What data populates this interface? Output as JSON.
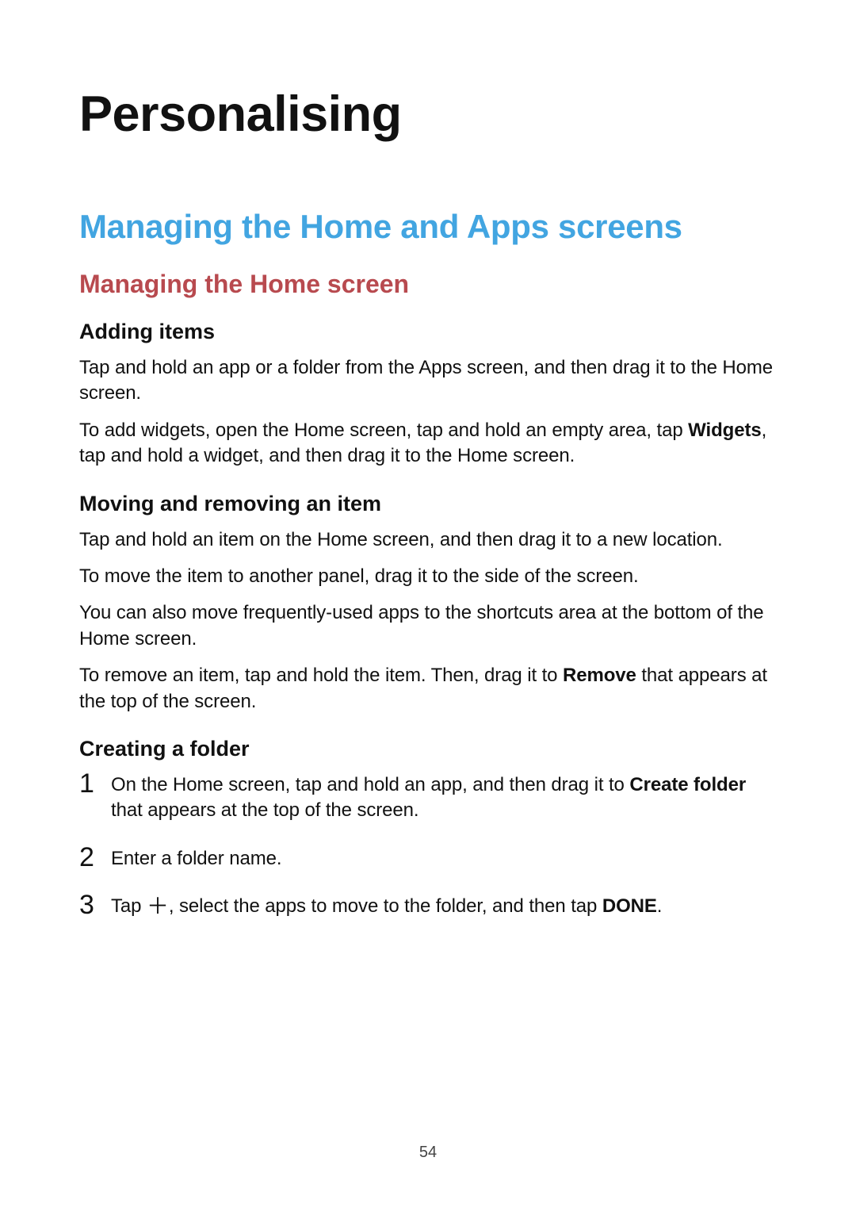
{
  "chapter": {
    "title": "Personalising"
  },
  "section": {
    "title": "Managing the Home and Apps screens"
  },
  "subsection": {
    "title": "Managing the Home screen"
  },
  "topics": {
    "adding": {
      "title": "Adding items",
      "p1": "Tap and hold an app or a folder from the Apps screen, and then drag it to the Home screen.",
      "p2_a": "To add widgets, open the Home screen, tap and hold an empty area, tap ",
      "p2_bold": "Widgets",
      "p2_b": ", tap and hold a widget, and then drag it to the Home screen."
    },
    "moving": {
      "title": "Moving and removing an item",
      "p1": "Tap and hold an item on the Home screen, and then drag it to a new location.",
      "p2": "To move the item to another panel, drag it to the side of the screen.",
      "p3": "You can also move frequently-used apps to the shortcuts area at the bottom of the Home screen.",
      "p4_a": "To remove an item, tap and hold the item. Then, drag it to ",
      "p4_bold": "Remove",
      "p4_b": " that appears at the top of the screen."
    },
    "folder": {
      "title": "Creating a folder",
      "step1_a": "On the Home screen, tap and hold an app, and then drag it to ",
      "step1_bold": "Create folder",
      "step1_b": " that appears at the top of the screen.",
      "step2": "Enter a folder name.",
      "step3_a": "Tap ",
      "step3_icon": "＋",
      "step3_b": ", select the apps to move to the folder, and then tap ",
      "step3_bold": "DONE",
      "step3_c": "."
    }
  },
  "page_number": "54"
}
